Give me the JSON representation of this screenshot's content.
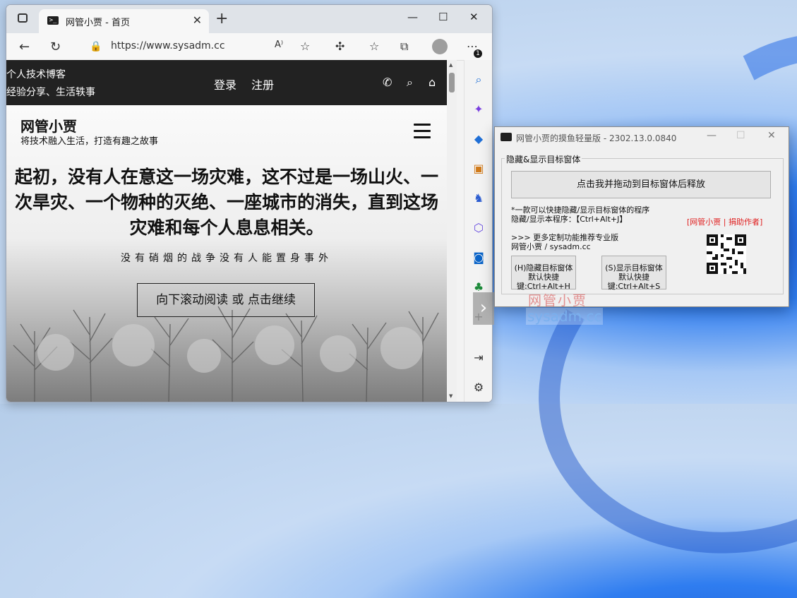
{
  "browser": {
    "tab_title": "网管小贾 - 首页",
    "tab_close": "✕",
    "new_tab": "+",
    "url": "https://www.sysadm.cc",
    "notification_count": "1"
  },
  "site": {
    "topbar_line1": "个人技术博客",
    "topbar_line2": "经验分享、生活轶事",
    "login": "登录",
    "register": "注册",
    "brand": "网管小贾",
    "slogan": "将技术融入生活，打造有趣之故事",
    "headline": "起初，没有人在意这一场灾难，这不过是一场山火、一次旱灾、一个物种的灭绝、一座城市的消失，直到这场灾难和每个人息息相关。",
    "subline": "没有硝烟的战争没有人能置身事外",
    "cta": "向下滚动阅读 或 点击继续"
  },
  "dialog": {
    "title": "网管小贾的摸鱼轻量版 - 2302.13.0.0840",
    "group_label": "隐藏&显示目标窗体",
    "drag_button": "点击我并拖动到目标窗体后释放",
    "desc_line1": "*一款可以快捷隐藏/显示目标窗体的程序",
    "desc_line2": "隐藏/显示本程序：【Ctrl+Alt+J】",
    "donate_link": "[网管小贾 | 捐助作者]",
    "promo_line1": ">>> 更多定制功能推荐专业版",
    "promo_line2": "网管小贾 / sysadm.cc",
    "hide_button_l1": "(H)隐藏目标窗体",
    "hide_button_l2": "默认快捷键:Ctrl+Alt+H",
    "show_button_l1": "(S)显示目标窗体",
    "show_button_l2": "默认快捷键:Ctrl+Alt+S"
  },
  "watermark": {
    "cn": "网管小贾",
    "en": "sysadm.cc"
  },
  "icons": {
    "sidebar": [
      "search-icon",
      "copilot-icon",
      "shopping-icon",
      "tools-icon",
      "games-icon",
      "microsoft365-icon",
      "outlook-icon",
      "tree-icon",
      "add-icon",
      "split-screen-icon",
      "settings-icon"
    ]
  }
}
